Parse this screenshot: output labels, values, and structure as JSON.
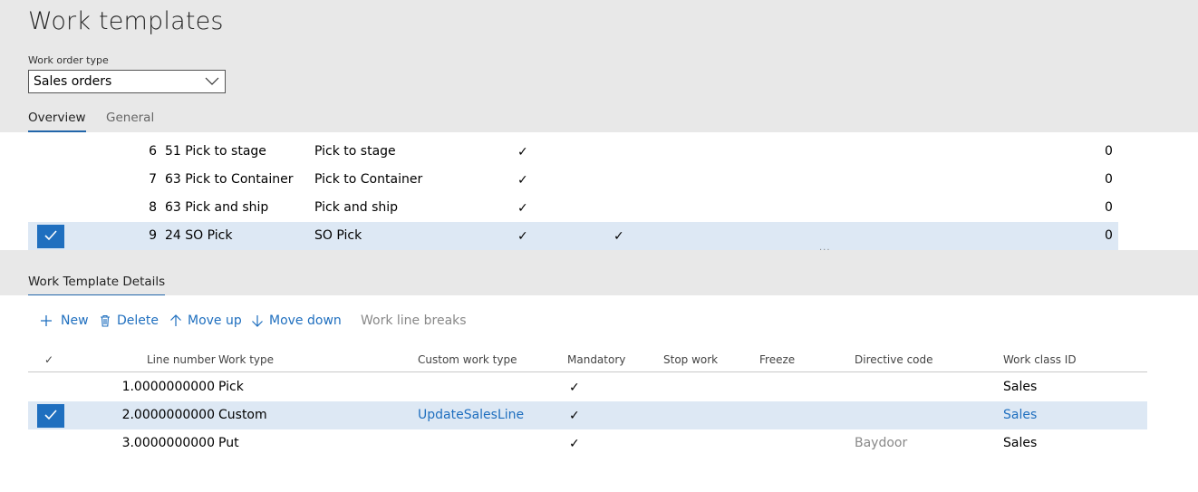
{
  "page": {
    "title": "Work templates"
  },
  "work_order_type": {
    "label": "Work order type",
    "value": "Sales orders"
  },
  "tabs": [
    {
      "label": "Overview",
      "active": true
    },
    {
      "label": "General",
      "active": false
    }
  ],
  "templates": {
    "rows": [
      {
        "seq": "6",
        "name": "51 Pick to stage",
        "description": "Pick to stage",
        "check1": "✓",
        "check2": "",
        "value": "0",
        "selected": false
      },
      {
        "seq": "7",
        "name": "63 Pick to Container",
        "description": "Pick to Container",
        "check1": "✓",
        "check2": "",
        "value": "0",
        "selected": false
      },
      {
        "seq": "8",
        "name": "63 Pick and ship",
        "description": "Pick and ship",
        "check1": "✓",
        "check2": "",
        "value": "0",
        "selected": false
      },
      {
        "seq": "9",
        "name": "24 SO Pick",
        "description": "SO Pick",
        "check1": "✓",
        "check2": "✓",
        "value": "0",
        "selected": true
      }
    ],
    "splitter": "..."
  },
  "details": {
    "tab_label": "Work Template Details",
    "toolbar": {
      "new_label": "New",
      "delete_label": "Delete",
      "move_up_label": "Move up",
      "move_down_label": "Move down",
      "work_line_breaks_label": "Work line breaks"
    },
    "columns": {
      "check": "✓",
      "line_number": "Line number",
      "work_type": "Work type",
      "custom_work_type": "Custom work type",
      "mandatory": "Mandatory",
      "stop_work": "Stop work",
      "freeze": "Freeze",
      "directive_code": "Directive code",
      "work_class_id": "Work class ID"
    },
    "rows": [
      {
        "line_number": "1.0000000000",
        "work_type": "Pick",
        "custom_work_type": "",
        "mandatory": "✓",
        "directive_code": "",
        "work_class_id": "Sales",
        "selected": false
      },
      {
        "line_number": "2.0000000000",
        "work_type": "Custom",
        "custom_work_type": "UpdateSalesLine",
        "mandatory": "✓",
        "directive_code": "",
        "work_class_id": "Sales",
        "selected": true
      },
      {
        "line_number": "3.0000000000",
        "work_type": "Put",
        "custom_work_type": "",
        "mandatory": "✓",
        "directive_code": "Baydoor",
        "work_class_id": "Sales",
        "selected": false
      }
    ]
  },
  "colors": {
    "accent": "#1f6fbf",
    "selected_row": "#dde8f4",
    "band": "#e8e8e8"
  }
}
